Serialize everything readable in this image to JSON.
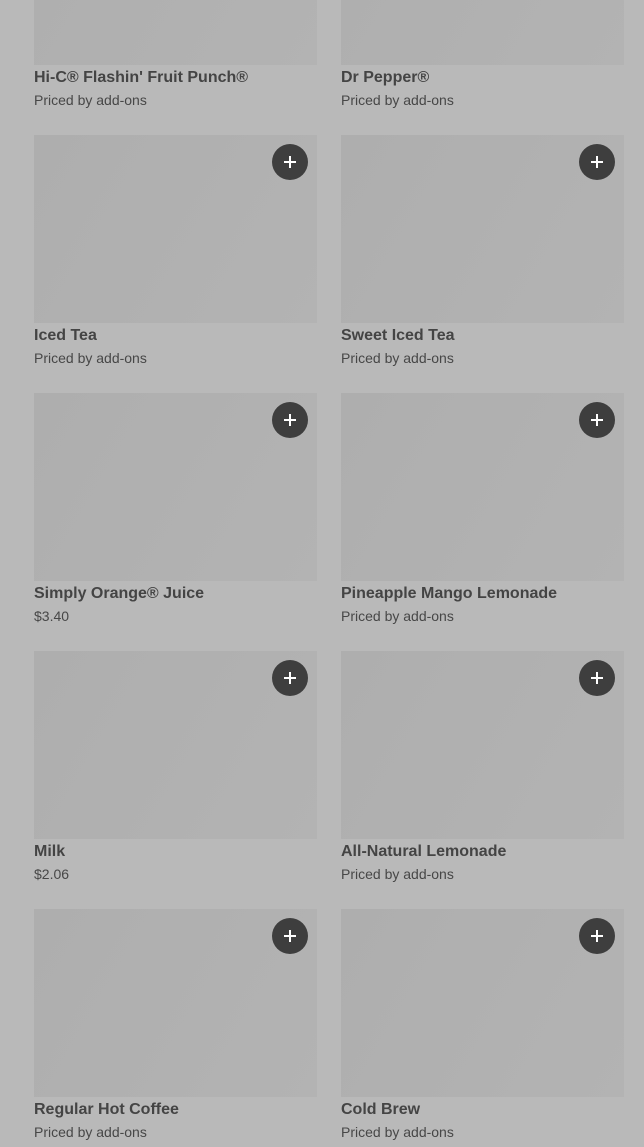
{
  "menu": {
    "items": [
      {
        "name": "Hi-C® Flashin' Fruit Punch®",
        "price": "Priced by add-ons"
      },
      {
        "name": "Dr Pepper®",
        "price": "Priced by add-ons"
      },
      {
        "name": "Iced Tea",
        "price": "Priced by add-ons"
      },
      {
        "name": "Sweet Iced Tea",
        "price": "Priced by add-ons"
      },
      {
        "name": "Simply Orange® Juice",
        "price": "$3.40"
      },
      {
        "name": "Pineapple Mango Lemonade",
        "price": "Priced by add-ons"
      },
      {
        "name": "Milk",
        "price": "$2.06"
      },
      {
        "name": "All-Natural Lemonade",
        "price": "Priced by add-ons"
      },
      {
        "name": "Regular Hot Coffee",
        "price": "Priced by add-ons"
      },
      {
        "name": "Cold Brew",
        "price": "Priced by add-ons"
      }
    ]
  },
  "icons": {
    "add_button": "plus-icon"
  },
  "colors": {
    "overlay_background": "#b9b9b9",
    "image_placeholder": "#afafaf",
    "add_button": "#3e3e3e",
    "text": "#444444"
  }
}
